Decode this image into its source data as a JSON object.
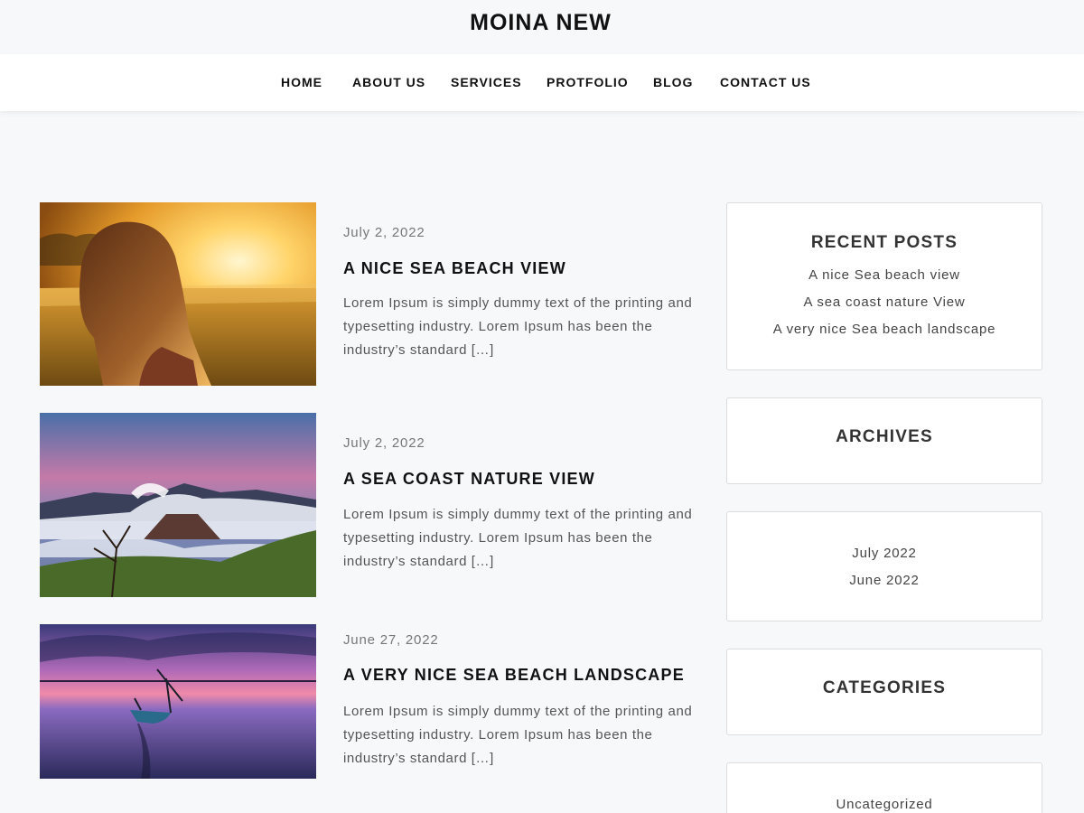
{
  "site": {
    "title": "MOINA NEW"
  },
  "nav": {
    "items": [
      {
        "label": "HOME"
      },
      {
        "label": "ABOUT US"
      },
      {
        "label": "SERVICES"
      },
      {
        "label": "PROTFOLIO"
      },
      {
        "label": "BLOG"
      },
      {
        "label": "CONTACT US"
      }
    ]
  },
  "posts": [
    {
      "date": "July 2, 2022",
      "title": "A NICE SEA BEACH VIEW",
      "excerpt": "Lorem Ipsum is simply dummy text of the printing and typesetting industry. Lorem Ipsum has been the industry’s standard […]",
      "image": "girl-in-sunset-field"
    },
    {
      "date": "July 2, 2022",
      "title": "A SEA COAST NATURE VIEW",
      "excerpt": "Lorem Ipsum is simply dummy text of the printing and typesetting industry. Lorem Ipsum has been the industry’s standard […]",
      "image": "volcano-landscape"
    },
    {
      "date": "June 27, 2022",
      "title": "A VERY NICE SEA BEACH LANDSCAPE",
      "excerpt": "Lorem Ipsum is simply dummy text of the printing and typesetting industry. Lorem Ipsum has been the industry’s standard […]",
      "image": "boat-at-sunset"
    }
  ],
  "sidebar": {
    "recent_posts": {
      "title": "RECENT POSTS",
      "items": [
        {
          "label": "A nice Sea beach view"
        },
        {
          "label": "A sea coast nature View"
        },
        {
          "label": "A very nice Sea beach landscape"
        }
      ]
    },
    "archives": {
      "title": "ARCHIVES",
      "items": [
        {
          "label": "July 2022"
        },
        {
          "label": "June 2022"
        }
      ]
    },
    "categories": {
      "title": "CATEGORIES",
      "items": [
        {
          "label": "Uncategorized"
        }
      ]
    }
  }
}
